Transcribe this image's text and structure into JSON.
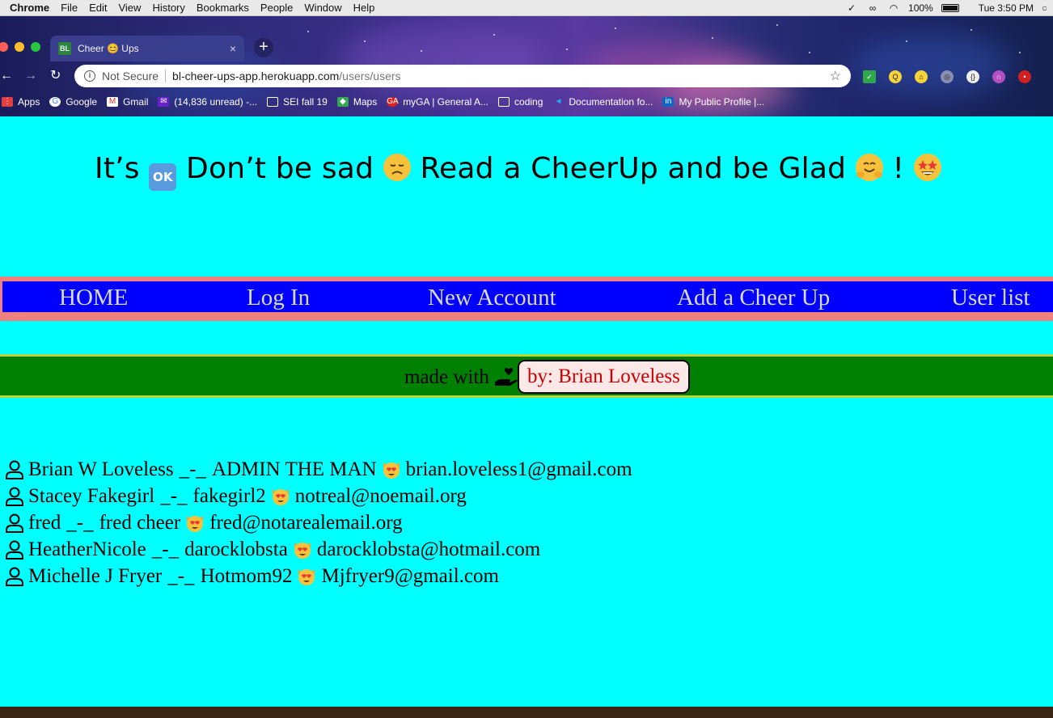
{
  "menubar": {
    "app": "Chrome",
    "items": [
      "File",
      "Edit",
      "View",
      "History",
      "Bookmarks",
      "People",
      "Window",
      "Help"
    ],
    "battery": "100%",
    "clock": "Tue 3:50 PM"
  },
  "tab": {
    "title": "Cheer 😊 Ups",
    "favicon": "BL"
  },
  "omnibox": {
    "security": "Not Secure",
    "host": "bl-cheer-ups-app.herokuapp.com",
    "path": "/users/users"
  },
  "bookmarks": [
    {
      "label": "Apps",
      "icon": "apps-icon"
    },
    {
      "label": "Google",
      "icon": "google-icon"
    },
    {
      "label": "Gmail",
      "icon": "gmail-icon"
    },
    {
      "label": "(14,836 unread) -...",
      "icon": "yahoo-mail-icon"
    },
    {
      "label": "SEI fall 19",
      "icon": "folder-icon"
    },
    {
      "label": "Maps",
      "icon": "maps-icon"
    },
    {
      "label": "myGA | General A...",
      "icon": "ga-icon"
    },
    {
      "label": "coding",
      "icon": "folder-icon"
    },
    {
      "label": "Documentation fo...",
      "icon": "vscode-icon"
    },
    {
      "label": "My Public Profile |...",
      "icon": "linkedin-icon"
    }
  ],
  "page": {
    "headline": {
      "part1": "It’s",
      "part2": "Don’t be sad",
      "part3": "Read a CheerUp and be Glad",
      "part4": "!"
    },
    "nav": [
      "HOME",
      "Log In",
      "New Account",
      "Add a Cheer Up",
      "User list"
    ],
    "footer": {
      "made_with": "made with",
      "byline": "by: Brian Loveless"
    },
    "users": [
      {
        "name": "Brian W Loveless",
        "sep": "_-_",
        "username": "ADMIN THE MAN",
        "email": "brian.loveless1@gmail.com"
      },
      {
        "name": "Stacey Fakegirl",
        "sep": "_-_",
        "username": "fakegirl2",
        "email": "notreal@noemail.org"
      },
      {
        "name": "fred",
        "sep": "_-_",
        "username": "fred cheer",
        "email": "fred@notarealemail.org"
      },
      {
        "name": "HeatherNicole",
        "sep": "_-_",
        "username": "darocklobsta",
        "email": "darocklobsta@hotmail.com"
      },
      {
        "name": "Michelle J Fryer",
        "sep": "_-_",
        "username": "Hotmom92",
        "email": "Mjfryer9@gmail.com"
      }
    ]
  },
  "colors": {
    "page_bg": "#00ffff",
    "nav_bg": "#0000ff",
    "nav_border": "#f08080",
    "footer_bg": "#008000",
    "byline_text": "#cc0000"
  }
}
